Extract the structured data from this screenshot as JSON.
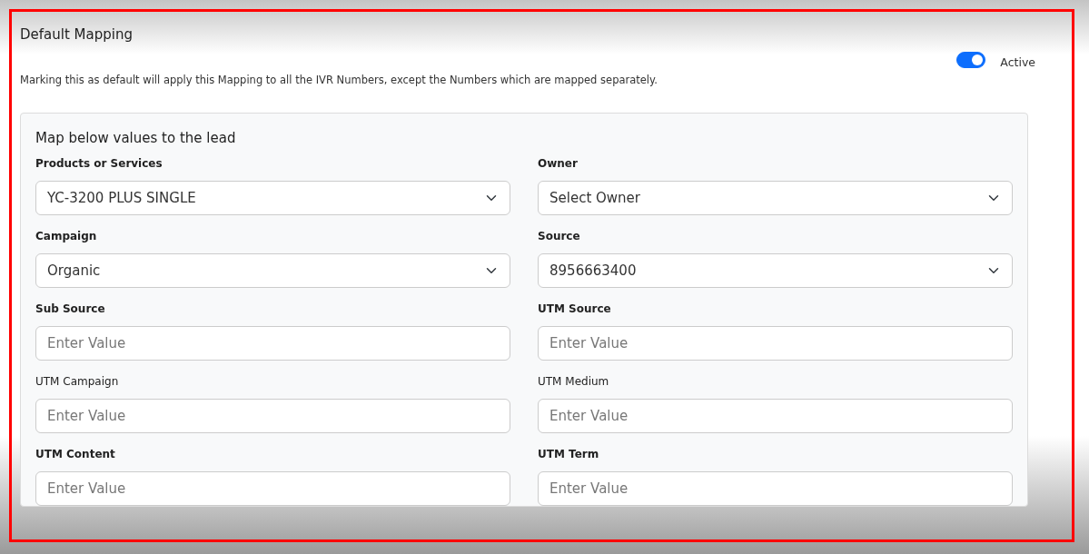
{
  "header": {
    "title": "Default Mapping",
    "description": "Marking this as default will apply this Mapping to all the IVR Numbers, except the Numbers which are mapped separately.",
    "active_toggle": {
      "label": "Active",
      "on": true
    }
  },
  "mapping_card": {
    "title": "Map below values to the lead",
    "fields": [
      {
        "label": "Products or Services",
        "kind": "select",
        "value": "YC-3200 PLUS SINGLE",
        "bold": true
      },
      {
        "label": "Owner",
        "kind": "select",
        "value": "Select Owner",
        "bold": true
      },
      {
        "label": "Campaign",
        "kind": "select",
        "value": "Organic",
        "bold": true
      },
      {
        "label": "Source",
        "kind": "select",
        "value": "8956663400",
        "bold": true
      },
      {
        "label": "Sub Source",
        "kind": "input",
        "placeholder": "Enter Value",
        "bold": true
      },
      {
        "label": "UTM Source",
        "kind": "input",
        "placeholder": "Enter Value",
        "bold": true
      },
      {
        "label": "UTM Campaign",
        "kind": "input",
        "placeholder": "Enter Value",
        "bold": false
      },
      {
        "label": "UTM Medium",
        "kind": "input",
        "placeholder": "Enter Value",
        "bold": false
      },
      {
        "label": "UTM Content",
        "kind": "input",
        "placeholder": "Enter Value",
        "bold": true
      },
      {
        "label": "UTM Term",
        "kind": "input",
        "placeholder": "Enter Value",
        "bold": true
      }
    ]
  }
}
